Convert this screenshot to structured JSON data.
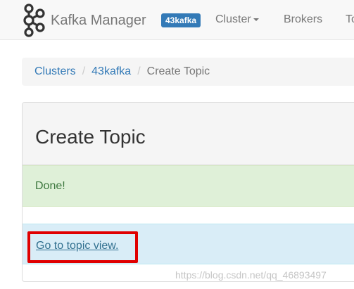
{
  "navbar": {
    "brand_text": "Kafka Manager",
    "logo_icon": "kafka-logo-icon",
    "cluster_badge": "43kafka",
    "items": [
      {
        "label": "Cluster",
        "has_dropdown": true
      },
      {
        "label": "Brokers"
      },
      {
        "label": "To"
      }
    ]
  },
  "breadcrumb": {
    "items": [
      {
        "label": "Clusters",
        "link": true
      },
      {
        "label": "43kafka",
        "link": true
      },
      {
        "label": "Create Topic",
        "link": false
      }
    ],
    "separator": "/"
  },
  "panel": {
    "title": "Create Topic",
    "success_message": "Done!",
    "link_text": "Go to topic view."
  },
  "watermark": "https://blog.csdn.net/qq_46893497",
  "colors": {
    "link": "#337ab7",
    "badge": "#337ab7",
    "success_bg": "#dff0d8",
    "success_text": "#3c763d",
    "info_bg": "#d9edf7",
    "info_text": "#31708f",
    "highlight": "#e00000"
  }
}
